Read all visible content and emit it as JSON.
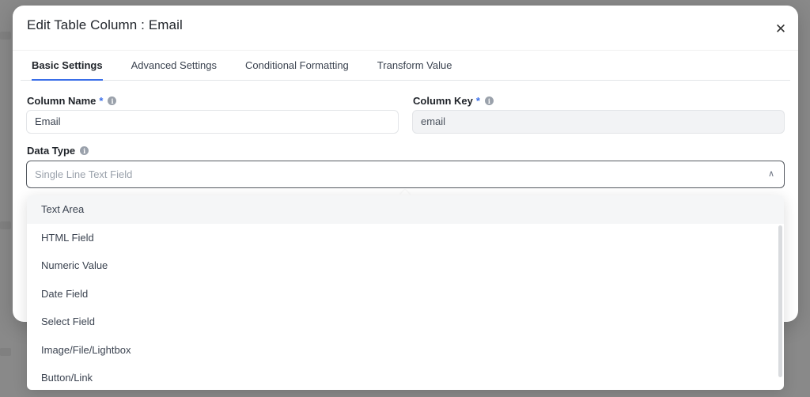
{
  "modal": {
    "title": "Edit Table Column : Email",
    "close_icon": "close-icon"
  },
  "tabs": [
    {
      "label": "Basic Settings",
      "active": true
    },
    {
      "label": "Advanced Settings",
      "active": false
    },
    {
      "label": "Conditional Formatting",
      "active": false
    },
    {
      "label": "Transform Value",
      "active": false
    }
  ],
  "form": {
    "column_name": {
      "label": "Column Name",
      "required_mark": "*",
      "value": "Email"
    },
    "column_key": {
      "label": "Column Key",
      "required_mark": "*",
      "value": "email"
    },
    "data_type": {
      "label": "Data Type",
      "placeholder": "Single Line Text Field"
    }
  },
  "dropdown": {
    "options": [
      "Text Area",
      "HTML Field",
      "Numeric Value",
      "Date Field",
      "Select Field",
      "Image/File/Lightbox",
      "Button/Link"
    ],
    "hovered_index": 0
  },
  "colors": {
    "accent": "#3a6ee8",
    "overlay": "#5a5a5a"
  }
}
